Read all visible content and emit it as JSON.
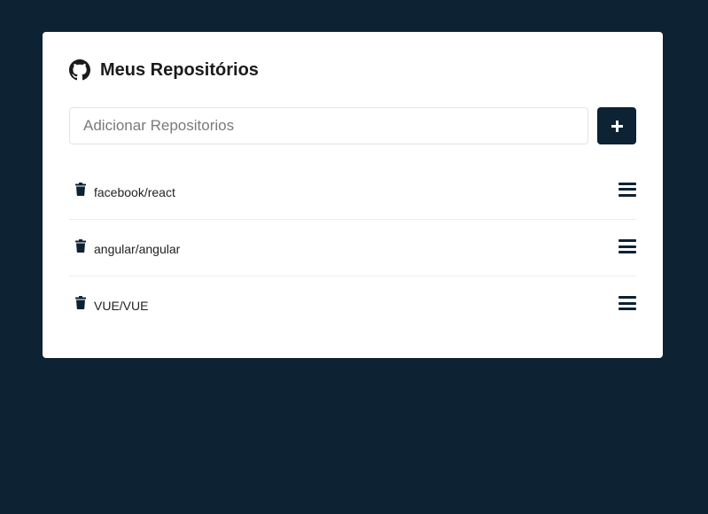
{
  "header": {
    "title": "Meus Repositórios"
  },
  "form": {
    "placeholder": "Adicionar Repositorios",
    "value": "",
    "add_label": "+"
  },
  "repositories": [
    {
      "name": "facebook/react"
    },
    {
      "name": "angular/angular"
    },
    {
      "name": "VUE/VUE"
    }
  ],
  "colors": {
    "background": "#0d2233",
    "card": "#ffffff",
    "accent": "#0d2233"
  },
  "icons": {
    "title": "github-icon",
    "add": "plus-icon",
    "delete": "trash-icon",
    "details": "menu-icon"
  }
}
